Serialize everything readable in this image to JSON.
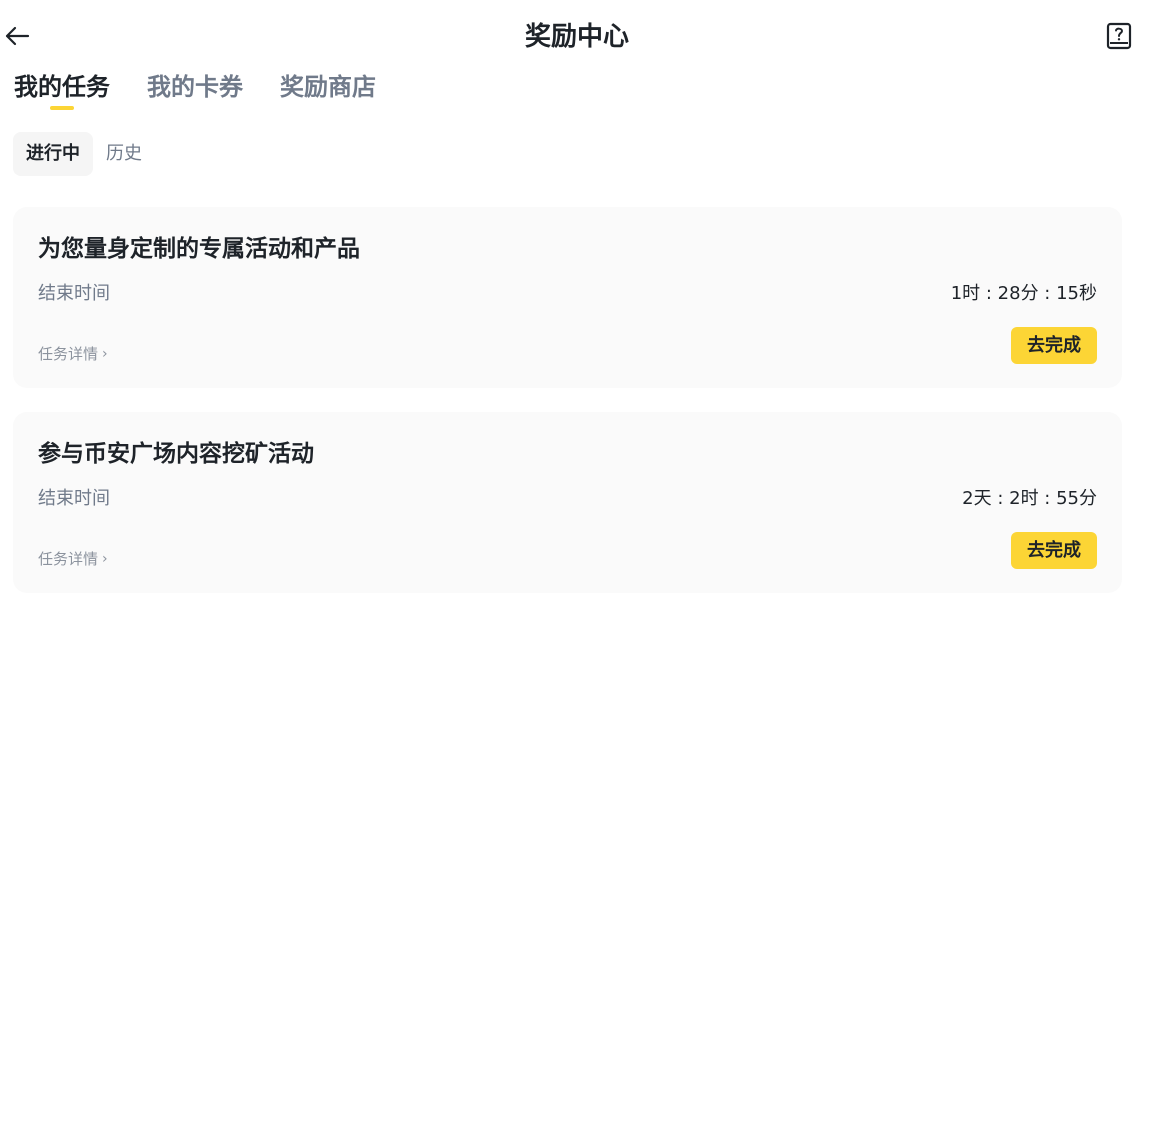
{
  "header": {
    "title": "奖励中心",
    "back_icon": "arrow-left-icon",
    "help_icon": "help-book-icon"
  },
  "main_tabs": [
    {
      "label": "我的任务",
      "active": true
    },
    {
      "label": "我的卡券",
      "active": false
    },
    {
      "label": "奖励商店",
      "active": false
    }
  ],
  "sub_tabs": [
    {
      "label": "进行中",
      "active": true
    },
    {
      "label": "历史",
      "active": false
    }
  ],
  "tasks": [
    {
      "title": "为您量身定制的专属活动和产品",
      "end_label": "结束时间",
      "countdown": "1时 : 28分 : 15秒",
      "detail_label": "任务详情",
      "action_label": "去完成"
    },
    {
      "title": "参与币安广场内容挖矿活动",
      "end_label": "结束时间",
      "countdown": "2天 : 2时 : 55分",
      "detail_label": "任务详情",
      "action_label": "去完成"
    }
  ],
  "colors": {
    "accent": "#fcd535",
    "text_primary": "#1e2329",
    "text_secondary": "#707a8a",
    "card_bg": "#fafafa"
  }
}
